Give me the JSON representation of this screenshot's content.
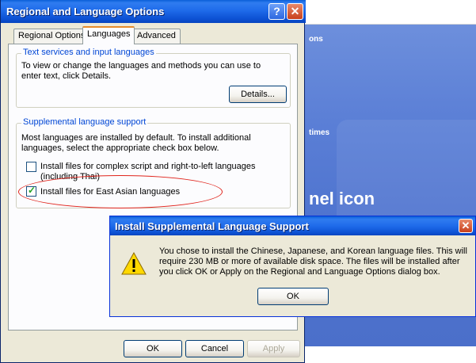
{
  "background_window": {
    "heading_fragment_1": "ons",
    "heading_fragment_2": "times",
    "heading_fragment_3": "nel icon"
  },
  "dialog": {
    "title": "Regional and Language Options",
    "help_label": "?",
    "close_label": "✕",
    "tabs": [
      "Regional Options",
      "Languages",
      "Advanced"
    ],
    "active_tab": "Languages",
    "text_services": {
      "legend": "Text services and input languages",
      "description": "To view or change the languages and methods you can use to enter text, click Details.",
      "details_button": "Details..."
    },
    "supplemental": {
      "legend": "Supplemental language support",
      "description": "Most languages are installed by default. To install additional languages, select the appropriate check box below.",
      "checkbox_complex": {
        "label": "Install files for complex script and right-to-left languages (including Thai)",
        "checked": false
      },
      "checkbox_east_asian": {
        "label": "Install files for East Asian languages",
        "checked": true
      }
    },
    "buttons": {
      "ok": "OK",
      "cancel": "Cancel",
      "apply": "Apply"
    }
  },
  "message_box": {
    "title": "Install Supplemental Language Support",
    "close_label": "✕",
    "icon": "warning-icon",
    "text": "You chose to install the Chinese, Japanese, and Korean language files. This will require 230 MB or more of available disk space. The files will be installed after you click OK or Apply on the Regional and Language Options dialog box.",
    "ok_button": "OK"
  },
  "colors": {
    "titlebar": "#1f6bea",
    "dialog_face": "#ece9d8",
    "group_legend": "#0046d5",
    "highlight_ellipse": "#e0241c",
    "background_panel": "#5b7fd6"
  }
}
